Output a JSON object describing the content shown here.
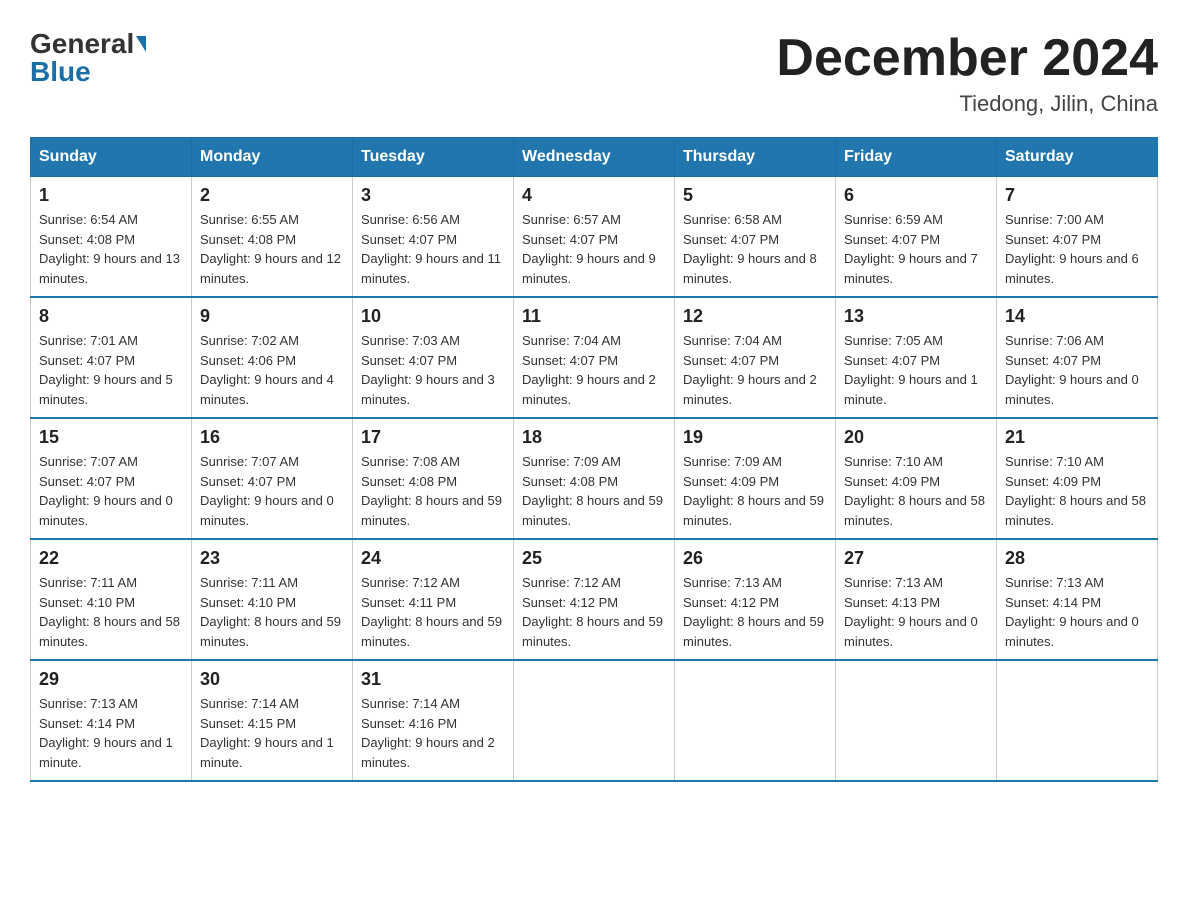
{
  "header": {
    "logo_general": "General",
    "logo_blue": "Blue",
    "month_title": "December 2024",
    "location": "Tiedong, Jilin, China"
  },
  "days_of_week": [
    "Sunday",
    "Monday",
    "Tuesday",
    "Wednesday",
    "Thursday",
    "Friday",
    "Saturday"
  ],
  "weeks": [
    [
      {
        "day": "1",
        "sunrise": "6:54 AM",
        "sunset": "4:08 PM",
        "daylight": "9 hours and 13 minutes."
      },
      {
        "day": "2",
        "sunrise": "6:55 AM",
        "sunset": "4:08 PM",
        "daylight": "9 hours and 12 minutes."
      },
      {
        "day": "3",
        "sunrise": "6:56 AM",
        "sunset": "4:07 PM",
        "daylight": "9 hours and 11 minutes."
      },
      {
        "day": "4",
        "sunrise": "6:57 AM",
        "sunset": "4:07 PM",
        "daylight": "9 hours and 9 minutes."
      },
      {
        "day": "5",
        "sunrise": "6:58 AM",
        "sunset": "4:07 PM",
        "daylight": "9 hours and 8 minutes."
      },
      {
        "day": "6",
        "sunrise": "6:59 AM",
        "sunset": "4:07 PM",
        "daylight": "9 hours and 7 minutes."
      },
      {
        "day": "7",
        "sunrise": "7:00 AM",
        "sunset": "4:07 PM",
        "daylight": "9 hours and 6 minutes."
      }
    ],
    [
      {
        "day": "8",
        "sunrise": "7:01 AM",
        "sunset": "4:07 PM",
        "daylight": "9 hours and 5 minutes."
      },
      {
        "day": "9",
        "sunrise": "7:02 AM",
        "sunset": "4:06 PM",
        "daylight": "9 hours and 4 minutes."
      },
      {
        "day": "10",
        "sunrise": "7:03 AM",
        "sunset": "4:07 PM",
        "daylight": "9 hours and 3 minutes."
      },
      {
        "day": "11",
        "sunrise": "7:04 AM",
        "sunset": "4:07 PM",
        "daylight": "9 hours and 2 minutes."
      },
      {
        "day": "12",
        "sunrise": "7:04 AM",
        "sunset": "4:07 PM",
        "daylight": "9 hours and 2 minutes."
      },
      {
        "day": "13",
        "sunrise": "7:05 AM",
        "sunset": "4:07 PM",
        "daylight": "9 hours and 1 minute."
      },
      {
        "day": "14",
        "sunrise": "7:06 AM",
        "sunset": "4:07 PM",
        "daylight": "9 hours and 0 minutes."
      }
    ],
    [
      {
        "day": "15",
        "sunrise": "7:07 AM",
        "sunset": "4:07 PM",
        "daylight": "9 hours and 0 minutes."
      },
      {
        "day": "16",
        "sunrise": "7:07 AM",
        "sunset": "4:07 PM",
        "daylight": "9 hours and 0 minutes."
      },
      {
        "day": "17",
        "sunrise": "7:08 AM",
        "sunset": "4:08 PM",
        "daylight": "8 hours and 59 minutes."
      },
      {
        "day": "18",
        "sunrise": "7:09 AM",
        "sunset": "4:08 PM",
        "daylight": "8 hours and 59 minutes."
      },
      {
        "day": "19",
        "sunrise": "7:09 AM",
        "sunset": "4:09 PM",
        "daylight": "8 hours and 59 minutes."
      },
      {
        "day": "20",
        "sunrise": "7:10 AM",
        "sunset": "4:09 PM",
        "daylight": "8 hours and 58 minutes."
      },
      {
        "day": "21",
        "sunrise": "7:10 AM",
        "sunset": "4:09 PM",
        "daylight": "8 hours and 58 minutes."
      }
    ],
    [
      {
        "day": "22",
        "sunrise": "7:11 AM",
        "sunset": "4:10 PM",
        "daylight": "8 hours and 58 minutes."
      },
      {
        "day": "23",
        "sunrise": "7:11 AM",
        "sunset": "4:10 PM",
        "daylight": "8 hours and 59 minutes."
      },
      {
        "day": "24",
        "sunrise": "7:12 AM",
        "sunset": "4:11 PM",
        "daylight": "8 hours and 59 minutes."
      },
      {
        "day": "25",
        "sunrise": "7:12 AM",
        "sunset": "4:12 PM",
        "daylight": "8 hours and 59 minutes."
      },
      {
        "day": "26",
        "sunrise": "7:13 AM",
        "sunset": "4:12 PM",
        "daylight": "8 hours and 59 minutes."
      },
      {
        "day": "27",
        "sunrise": "7:13 AM",
        "sunset": "4:13 PM",
        "daylight": "9 hours and 0 minutes."
      },
      {
        "day": "28",
        "sunrise": "7:13 AM",
        "sunset": "4:14 PM",
        "daylight": "9 hours and 0 minutes."
      }
    ],
    [
      {
        "day": "29",
        "sunrise": "7:13 AM",
        "sunset": "4:14 PM",
        "daylight": "9 hours and 1 minute."
      },
      {
        "day": "30",
        "sunrise": "7:14 AM",
        "sunset": "4:15 PM",
        "daylight": "9 hours and 1 minute."
      },
      {
        "day": "31",
        "sunrise": "7:14 AM",
        "sunset": "4:16 PM",
        "daylight": "9 hours and 2 minutes."
      },
      null,
      null,
      null,
      null
    ]
  ]
}
